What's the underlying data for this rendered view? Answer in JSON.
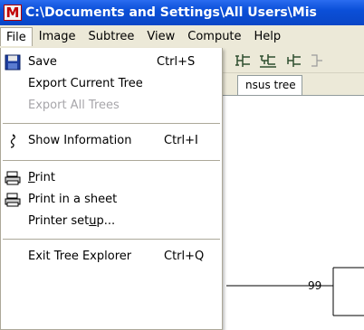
{
  "window": {
    "title": "C:\\Documents and Settings\\All Users\\Mis",
    "app_icon_letter": "M"
  },
  "menubar": {
    "items": [
      "File",
      "Image",
      "Subtree",
      "View",
      "Compute",
      "Help"
    ]
  },
  "tab": {
    "label": "nsus tree"
  },
  "canvas": {
    "node_label": "99"
  },
  "file_menu": {
    "save": {
      "label": "Save",
      "shortcut": "Ctrl+S"
    },
    "export_current": {
      "label": "Export Current Tree"
    },
    "export_all": {
      "label": "Export All Trees"
    },
    "show_info": {
      "label": "Show Information",
      "shortcut": "Ctrl+I"
    },
    "print": {
      "pre": "",
      "u": "P",
      "post": "rint"
    },
    "print_sheet": {
      "label": "Print in a sheet"
    },
    "printer_setup": {
      "pre": "Printer set",
      "u": "u",
      "post": "p..."
    },
    "exit": {
      "label": "Exit Tree Explorer",
      "shortcut": "Ctrl+Q"
    }
  },
  "colors": {
    "titlebar": "#0a46c6",
    "menu_bg": "#ece9d8",
    "disabled_text": "#a7a6aa"
  }
}
